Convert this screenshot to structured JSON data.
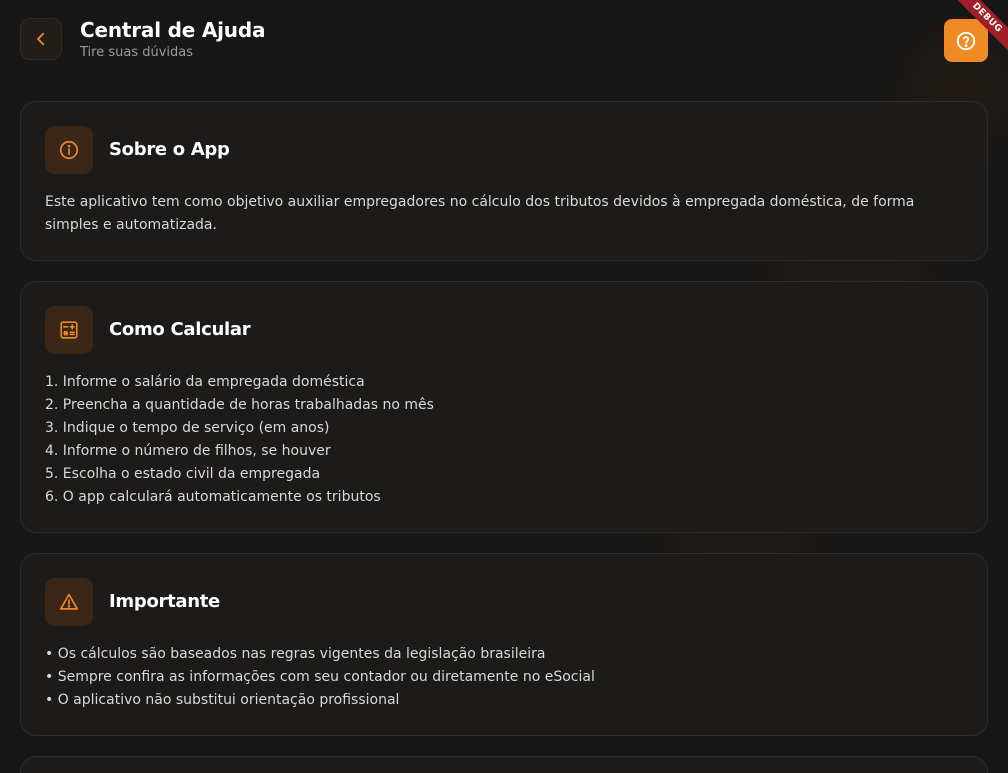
{
  "header": {
    "title": "Central de Ajuda",
    "subtitle": "Tire suas dúvidas",
    "debug_label": "DEBUG"
  },
  "icons": {
    "back": "chevron-left-icon",
    "help": "help-circle-icon",
    "info": "info-icon",
    "calculator": "calculator-icon",
    "warning": "warning-icon"
  },
  "colors": {
    "accent": "#f08a24",
    "background": "#171717",
    "card": "#1e1c1a",
    "debug": "#a01e2a"
  },
  "sections": {
    "about": {
      "title": "Sobre o App",
      "body": "Este aplicativo tem como objetivo auxiliar empregadores no cálculo dos tributos devidos à empregada doméstica, de forma simples e automatizada."
    },
    "how": {
      "title": "Como Calcular",
      "steps": [
        "1. Informe o salário da empregada doméstica",
        "2. Preencha a quantidade de horas trabalhadas no mês",
        "3. Indique o tempo de serviço (em anos)",
        "4. Informe o número de filhos, se houver",
        "5. Escolha o estado civil da empregada",
        "6. O app calculará automaticamente os tributos"
      ]
    },
    "important": {
      "title": "Importante",
      "notes": [
        "• Os cálculos são baseados nas regras vigentes da legislação brasileira",
        "• Sempre confira as informações com seu contador ou diretamente no eSocial",
        "• O aplicativo não substitui orientação profissional"
      ]
    }
  }
}
